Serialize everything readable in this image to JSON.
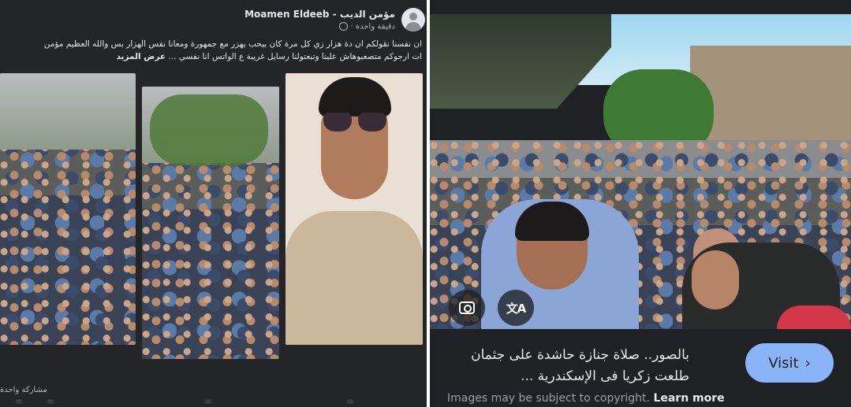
{
  "facebook_post": {
    "author_name": "مؤمن الديب - Moamen Eldeeb",
    "time_label": "دقيقة واحدة ·",
    "text_line1": "ان نفسنا نقولكم ان دة هزار زي كل مرة كان بيحب يهزر مع جمهورة ومعانا نفس الهزار بس والله العظيم مؤمن",
    "text_line2": "ات ارجوكم متصعبوهاش علينا وتبعتولنا رسايل غريبة ع الواتس انا نفسي ...",
    "see_more": "عرض المزيد",
    "share_label": "مشاركة واحدة",
    "photos": [
      "crowd-street-photo",
      "crowd-trees-photo",
      "selfie-sunglasses-photo"
    ]
  },
  "lens_result": {
    "result_title": "بالصور.. صلاة جنازة حاشدة على جثمان طلعت زكريا فى الإسكندرية ...",
    "visit_label": "Visit",
    "visit_icon": "chevron-right-icon",
    "copyright_note": "Images may be subject to copyright.",
    "learn_more": "Learn more",
    "overlay_buttons": [
      "camera-search-icon",
      "translate-icon"
    ],
    "accent_color": "#8ab4f8"
  }
}
